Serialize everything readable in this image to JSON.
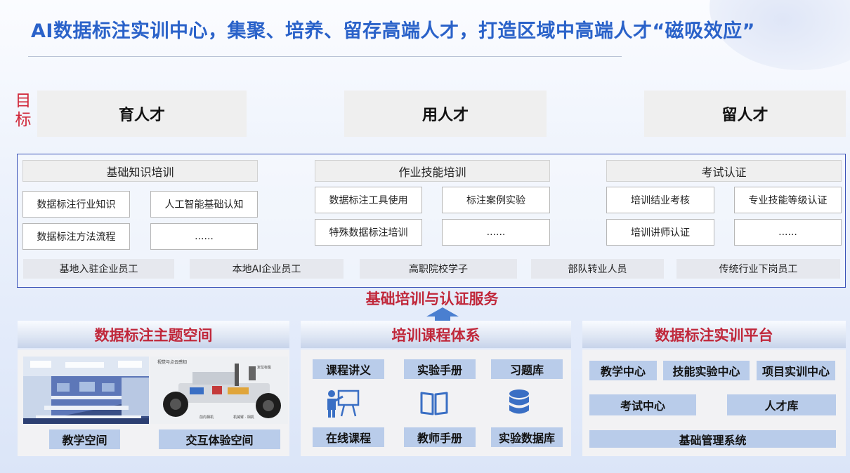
{
  "title": "AI数据标注实训中心，集聚、培养、留存高端人才，打造区域中高端人才“磁吸效应”",
  "goals": {
    "label_line1": "目",
    "label_line2": "标",
    "items": [
      "育人才",
      "用人才",
      "留人才"
    ]
  },
  "training": {
    "columns": [
      {
        "header": "基础知识培训",
        "items": [
          "数据标注行业知识",
          "人工智能基础认知",
          "数据标注方法流程",
          "......"
        ]
      },
      {
        "header": "作业技能培训",
        "items": [
          "数据标注工具使用",
          "标注案例实验",
          "特殊数据标注培训",
          "......"
        ]
      },
      {
        "header": "考试认证",
        "items": [
          "培训结业考核",
          "专业技能等级认证",
          "培训讲师认证",
          "......"
        ]
      }
    ],
    "audiences": [
      "基地入驻企业员工",
      "本地AI企业员工",
      "高职院校学子",
      "部队转业人员",
      "传统行业下岗员工"
    ]
  },
  "service_label": "基础培训与认证服务",
  "sections": {
    "space": {
      "title": "数据标注主题空间",
      "photo2_caption": "视觉与点云感知",
      "photo2_tag": "定位标签",
      "photo2_bottom_left": "前向相机",
      "photo2_bottom_right": "机械臂 · 相机",
      "tags": [
        "教学空间",
        "交互体验空间"
      ]
    },
    "courses": {
      "title": "培训课程体系",
      "row1": [
        "课程讲义",
        "实验手册",
        "习题库"
      ],
      "icons": [
        "presenter-icon",
        "book-icon",
        "database-icon"
      ],
      "row2": [
        "在线课程",
        "教师手册",
        "实验数据库"
      ]
    },
    "platform": {
      "title": "数据标注实训平台",
      "row1": [
        "教学中心",
        "技能实验中心",
        "项目实训中心"
      ],
      "row2": [
        "考试中心",
        "人才库"
      ],
      "row3": "基础管理系统"
    }
  },
  "colors": {
    "title_blue": "#2a62c9",
    "accent_red": "#c0273a",
    "tag_blue": "#b9ccea",
    "icon_blue": "#3a6fc4"
  }
}
